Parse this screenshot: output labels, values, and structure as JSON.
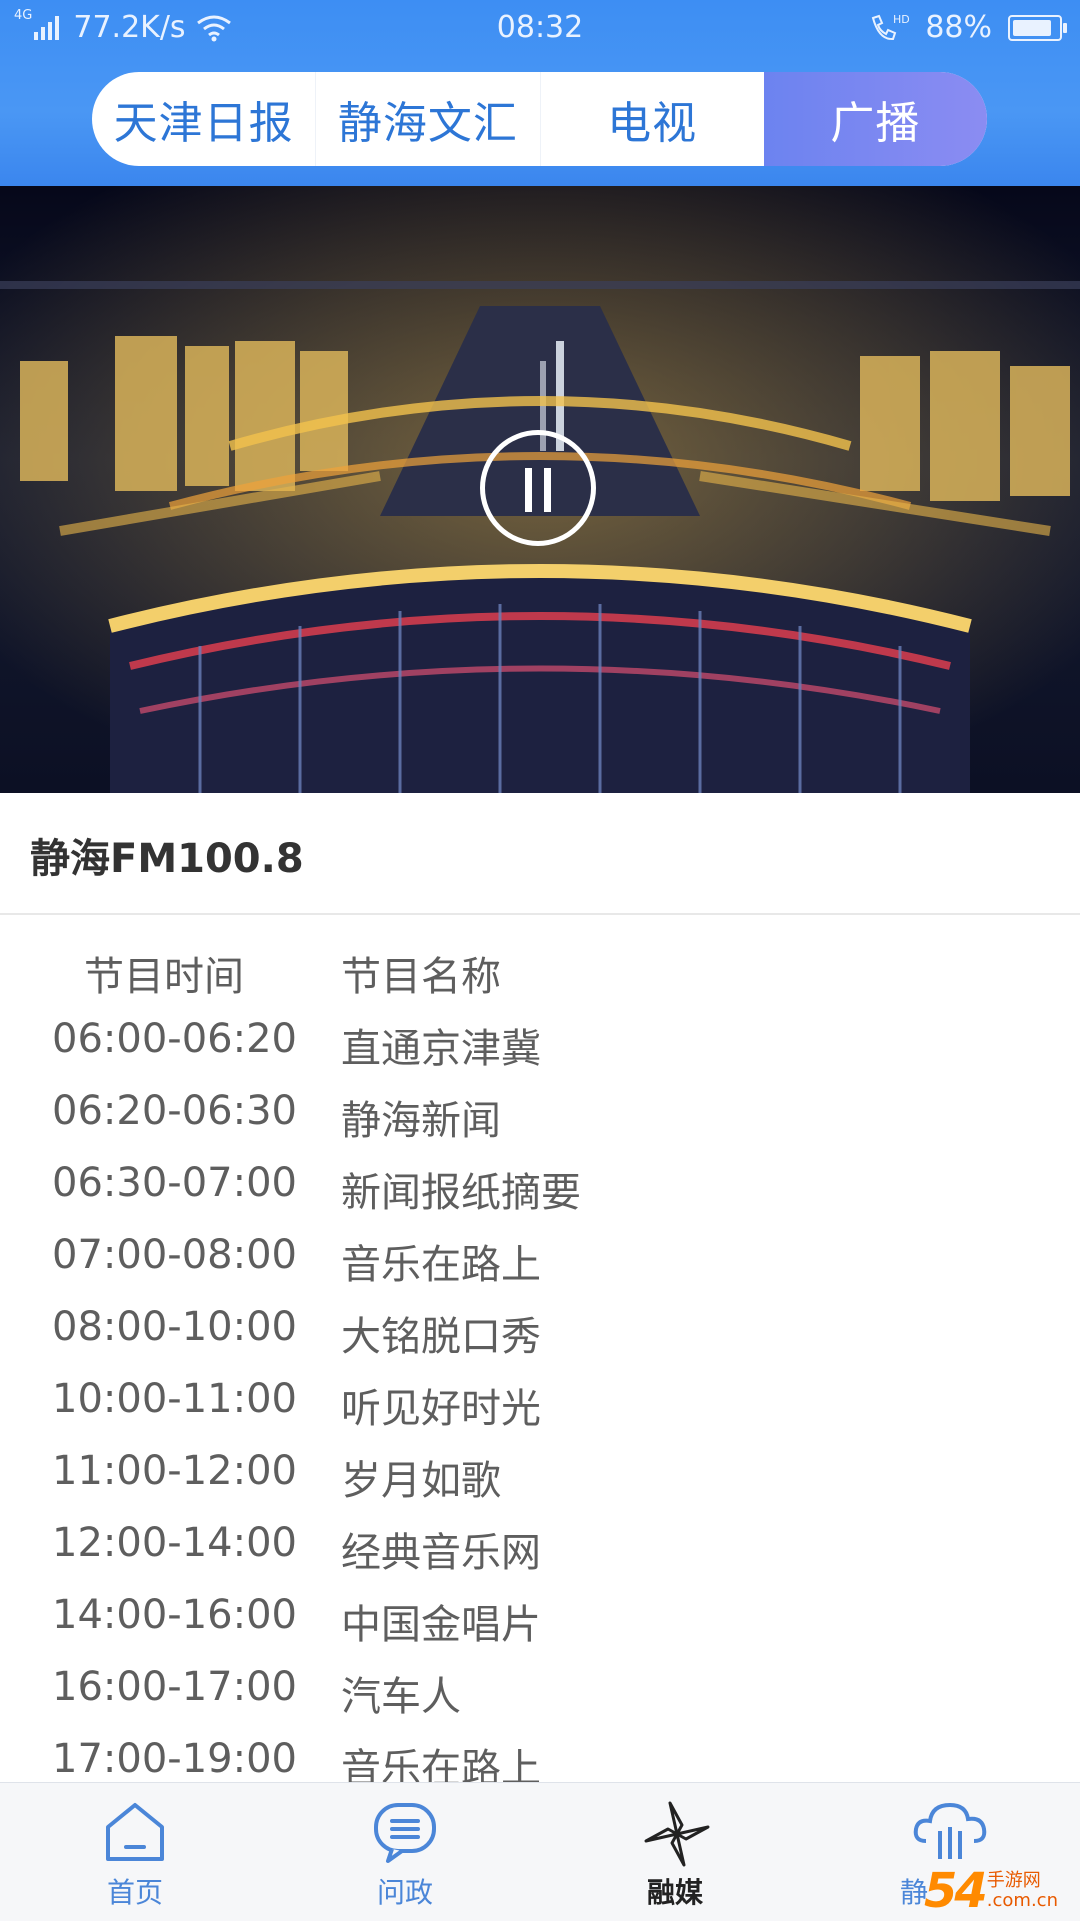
{
  "status_bar": {
    "network": "4G",
    "speed": "77.2K/s",
    "time": "08:32",
    "hd": "HD",
    "battery": "88%"
  },
  "tabs": [
    {
      "label": "天津日报",
      "active": false
    },
    {
      "label": "静海文汇",
      "active": false
    },
    {
      "label": "电视",
      "active": false
    },
    {
      "label": "广播",
      "active": true
    }
  ],
  "player": {
    "state": "playing",
    "control_icon": "pause-icon"
  },
  "station_name": "静海FM100.8",
  "schedule": {
    "headers": {
      "time": "节目时间",
      "name": "节目名称"
    },
    "rows": [
      {
        "time": "06:00-06:20",
        "name": "直通京津冀"
      },
      {
        "time": "06:20-06:30",
        "name": "静海新闻"
      },
      {
        "time": "06:30-07:00",
        "name": "新闻报纸摘要"
      },
      {
        "time": "07:00-08:00",
        "name": "音乐在路上"
      },
      {
        "time": "08:00-10:00",
        "name": "大铭脱口秀"
      },
      {
        "time": "10:00-11:00",
        "name": "听见好时光"
      },
      {
        "time": "11:00-12:00",
        "name": "岁月如歌"
      },
      {
        "time": "12:00-14:00",
        "name": "经典音乐网"
      },
      {
        "time": "14:00-16:00",
        "name": "中国金唱片"
      },
      {
        "time": "16:00-17:00",
        "name": "汽车人"
      },
      {
        "time": "17:00-19:00",
        "name": "音乐在路上"
      }
    ]
  },
  "bottom_nav": [
    {
      "label": "首页",
      "icon": "home-icon",
      "active": false
    },
    {
      "label": "问政",
      "icon": "chat-icon",
      "active": false
    },
    {
      "label": "融媒",
      "icon": "pinwheel-icon",
      "active": true
    },
    {
      "label": "静",
      "icon": "cloud-icon",
      "active": false
    }
  ],
  "watermark": {
    "number": "54",
    "text_top": "手游网",
    "text_bottom": ".com.cn"
  },
  "colors": {
    "header_blue": "#3d8ef3",
    "tab_active": "#7b88f1",
    "tab_text": "#2d76d6",
    "nav_text": "#4b86d8"
  }
}
